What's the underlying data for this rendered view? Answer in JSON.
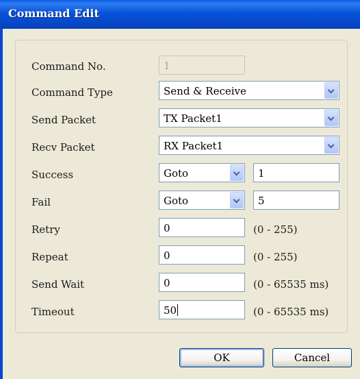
{
  "window": {
    "title": "Command Edit"
  },
  "form": {
    "command_no": {
      "label": "Command No.",
      "value": "1"
    },
    "command_type": {
      "label": "Command Type",
      "value": "Send & Receive"
    },
    "send_packet": {
      "label": "Send Packet",
      "value": "TX Packet1"
    },
    "recv_packet": {
      "label": "Recv Packet",
      "value": "RX Packet1"
    },
    "success": {
      "label": "Success",
      "action": "Goto",
      "target": "1"
    },
    "fail": {
      "label": "Fail",
      "action": "Goto",
      "target": "5"
    },
    "retry": {
      "label": "Retry",
      "value": "0",
      "range": "(0 - 255)"
    },
    "repeat": {
      "label": "Repeat",
      "value": "0",
      "range": "(0 - 255)"
    },
    "send_wait": {
      "label": "Send Wait",
      "value": "0",
      "range": "(0 - 65535 ms)"
    },
    "timeout": {
      "label": "Timeout",
      "value": "50",
      "range": "(0 - 65535 ms)"
    }
  },
  "buttons": {
    "ok": "OK",
    "cancel": "Cancel"
  },
  "icons": {
    "dropdown": "chevron-down-icon"
  },
  "colors": {
    "titlebar": "#0852D8",
    "dialog_bg": "#ECE9D8",
    "field_border": "#7F9DB9"
  }
}
